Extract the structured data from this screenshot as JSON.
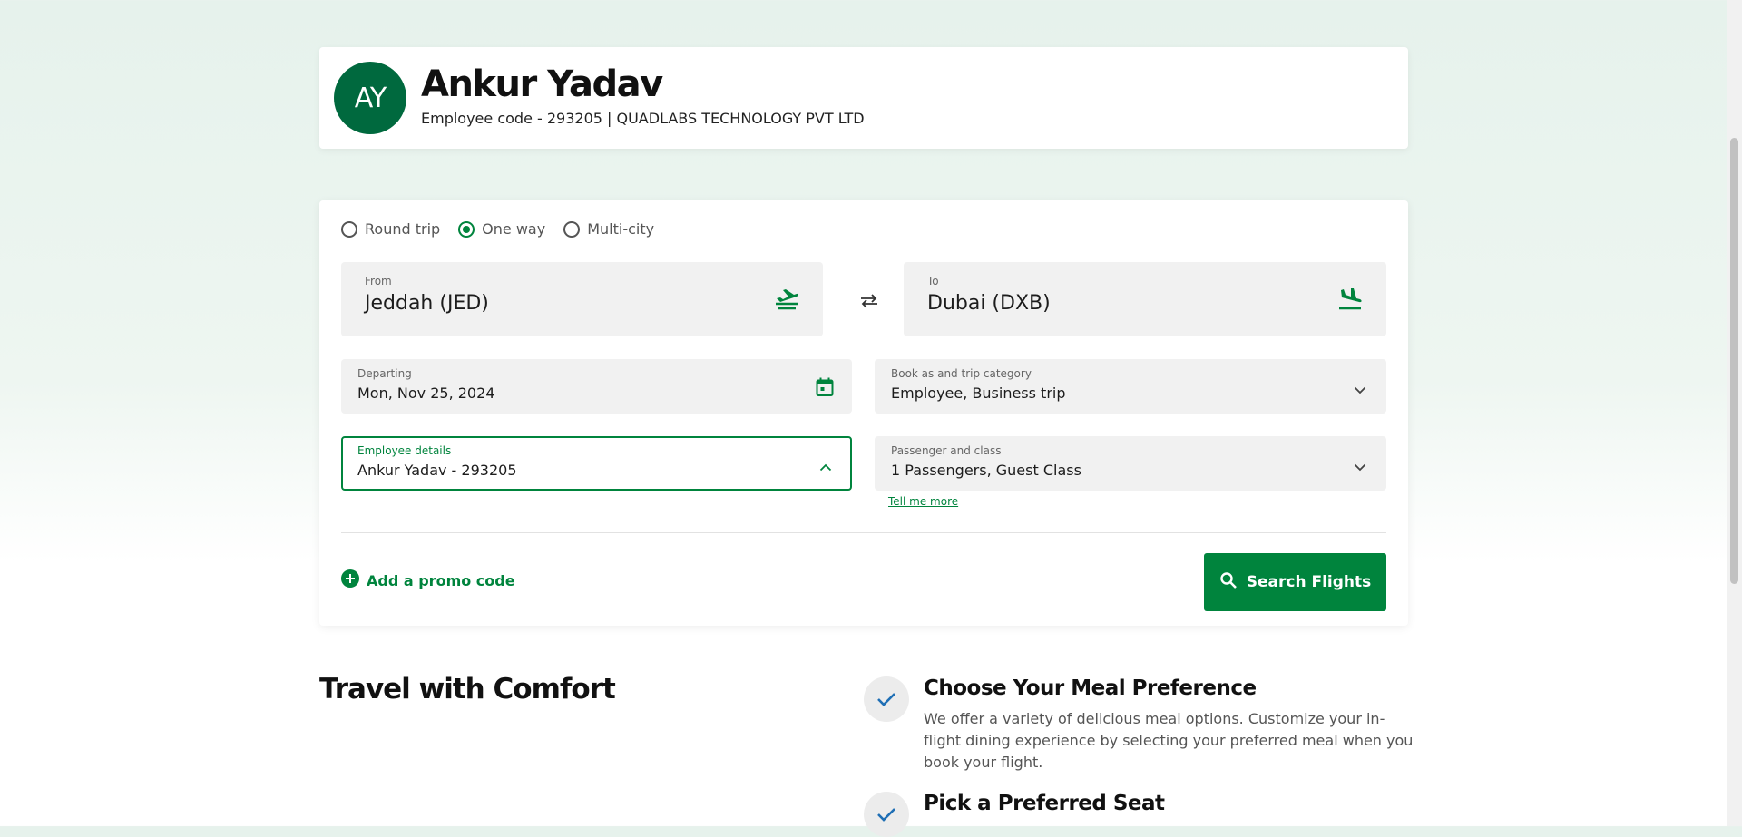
{
  "profile": {
    "initials": "AY",
    "name": "Ankur Yadav",
    "employee_line": "Employee code - 293205 | QUADLABS TECHNOLOGY PVT LTD"
  },
  "search": {
    "trip_types": [
      {
        "label": "Round trip",
        "checked": false
      },
      {
        "label": "One way",
        "checked": true
      },
      {
        "label": "Multi-city",
        "checked": false
      }
    ],
    "from": {
      "label": "From",
      "value": "Jeddah (JED)",
      "icon": "takeoff-icon"
    },
    "to": {
      "label": "To",
      "value": "Dubai (DXB)",
      "icon": "landing-icon"
    },
    "swap_icon": "swap-arrows-icon",
    "departing": {
      "label": "Departing",
      "value": "Mon, Nov 25, 2024",
      "icon": "calendar-icon"
    },
    "book_as": {
      "label": "Book as and trip category",
      "value": "Employee, Business trip",
      "icon": "chevron-down-icon"
    },
    "employee": {
      "label": "Employee details",
      "value": "Ankur Yadav - 293205",
      "icon": "chevron-up-icon"
    },
    "passengers": {
      "label": "Passenger and class",
      "value": "1 Passengers, Guest Class",
      "icon": "chevron-down-icon"
    },
    "tell_more": "Tell me more",
    "promo_label": "Add a promo code",
    "search_button": "Search Flights"
  },
  "comfort": {
    "title": "Travel with Comfort",
    "features": [
      {
        "title": "Choose Your Meal Preference",
        "desc": "We offer a variety of delicious meal options. Customize your in-flight dining experience by selecting your preferred meal when you book your flight."
      },
      {
        "title": "Pick a Preferred Seat",
        "desc": ""
      }
    ]
  },
  "colors": {
    "brand_green": "#00843d",
    "avatar_green": "#00693e",
    "check_blue": "#1f6fb5"
  }
}
